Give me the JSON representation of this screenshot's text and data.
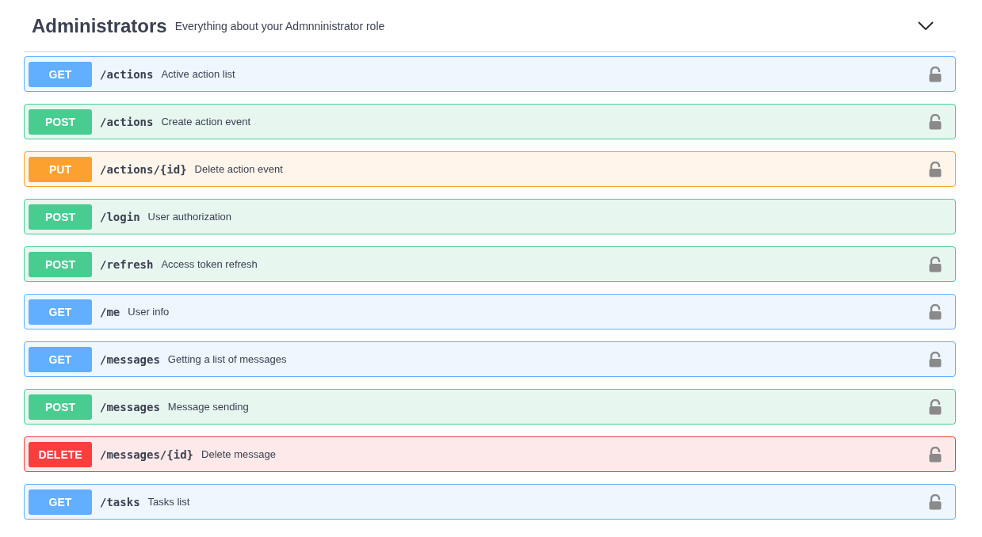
{
  "section": {
    "title": "Administrators",
    "description": "Everything about your Admnninistrator role"
  },
  "operations": [
    {
      "kind": "get",
      "method": "GET",
      "path": "/actions",
      "summary": "Active action list",
      "locked": true
    },
    {
      "kind": "post",
      "method": "POST",
      "path": "/actions",
      "summary": "Create action event",
      "locked": true
    },
    {
      "kind": "put",
      "method": "PUT",
      "path": "/actions/{id}",
      "summary": "Delete action event",
      "locked": true
    },
    {
      "kind": "post",
      "method": "POST",
      "path": "/login",
      "summary": "User authorization",
      "locked": false
    },
    {
      "kind": "post",
      "method": "POST",
      "path": "/refresh",
      "summary": "Access token refresh",
      "locked": true
    },
    {
      "kind": "get",
      "method": "GET",
      "path": "/me",
      "summary": "User info",
      "locked": true
    },
    {
      "kind": "get",
      "method": "GET",
      "path": "/messages",
      "summary": "Getting a list of messages",
      "locked": true
    },
    {
      "kind": "post",
      "method": "POST",
      "path": "/messages",
      "summary": "Message sending",
      "locked": true
    },
    {
      "kind": "delete",
      "method": "DELETE",
      "path": "/messages/{id}",
      "summary": "Delete message",
      "locked": true
    },
    {
      "kind": "get",
      "method": "GET",
      "path": "/tasks",
      "summary": "Tasks list",
      "locked": true
    }
  ]
}
